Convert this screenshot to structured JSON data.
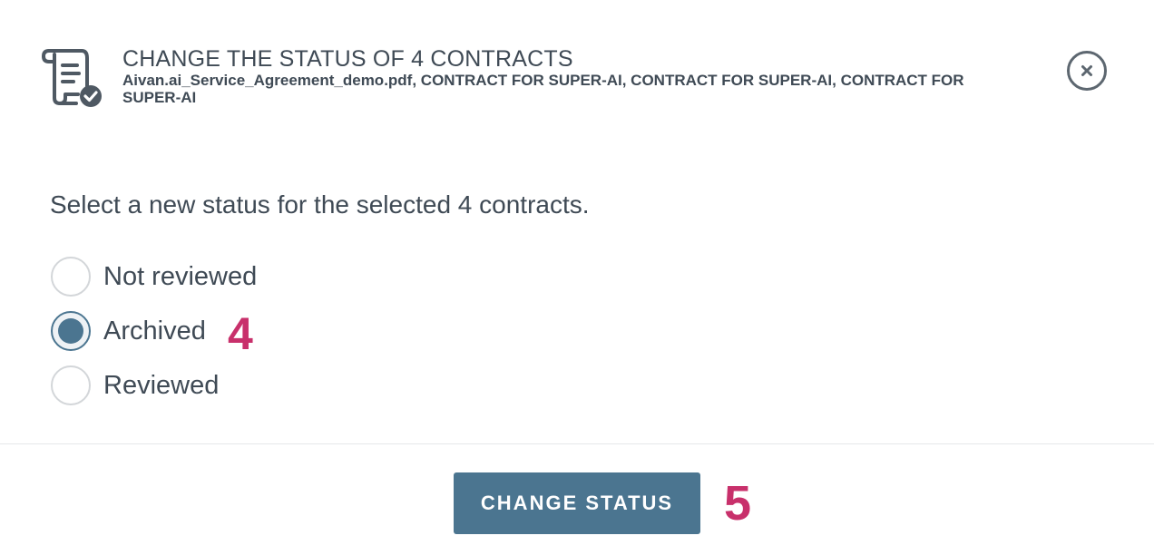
{
  "header": {
    "title": "CHANGE THE STATUS OF 4 CONTRACTS",
    "subtitle": "Aivan.ai_Service_Agreement_demo.pdf, CONTRACT FOR SUPER-AI, CONTRACT FOR SUPER-AI, CONTRACT FOR SUPER-AI",
    "icon": "contract-scroll-check-icon",
    "close_icon": "close-icon"
  },
  "body": {
    "prompt": "Select a new status for the selected 4 contracts.",
    "options": [
      {
        "label": "Not reviewed",
        "checked": false
      },
      {
        "label": "Archived",
        "checked": true
      },
      {
        "label": "Reviewed",
        "checked": false
      }
    ]
  },
  "footer": {
    "button_label": "CHANGE STATUS"
  },
  "annotations": {
    "step_4": "4",
    "step_5": "5"
  },
  "colors": {
    "accent": "#4b7590",
    "annotation": "#c8306b",
    "text": "#3f4a55"
  }
}
